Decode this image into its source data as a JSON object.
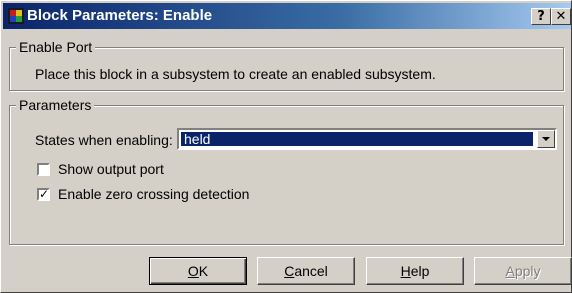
{
  "window": {
    "title": "Block Parameters: Enable",
    "help_glyph": "?",
    "close_glyph": "✕"
  },
  "enable_port": {
    "legend": "Enable Port",
    "description": "Place this block in a subsystem to create an enabled subsystem."
  },
  "parameters": {
    "legend": "Parameters",
    "states_label": "States when enabling:",
    "states_value": "held",
    "show_output_port": {
      "label": "Show output port",
      "checked": false
    },
    "zero_crossing": {
      "label": "Enable zero crossing detection",
      "checked": true
    }
  },
  "buttons": {
    "ok": {
      "mnemonic": "O",
      "rest": "K"
    },
    "cancel": {
      "mnemonic": "C",
      "rest": "ancel"
    },
    "help": {
      "mnemonic": "H",
      "rest": "elp"
    },
    "apply": {
      "mnemonic": "A",
      "rest": "pply",
      "disabled": true
    }
  },
  "colors": {
    "title_start": "#0a246a",
    "title_end": "#a6caf0",
    "face": "#d4d0c8",
    "selection": "#0a246a"
  },
  "icons": [
    "simulink-block-icon",
    "help-icon",
    "close-icon",
    "chevron-down-icon",
    "checkmark-icon"
  ]
}
